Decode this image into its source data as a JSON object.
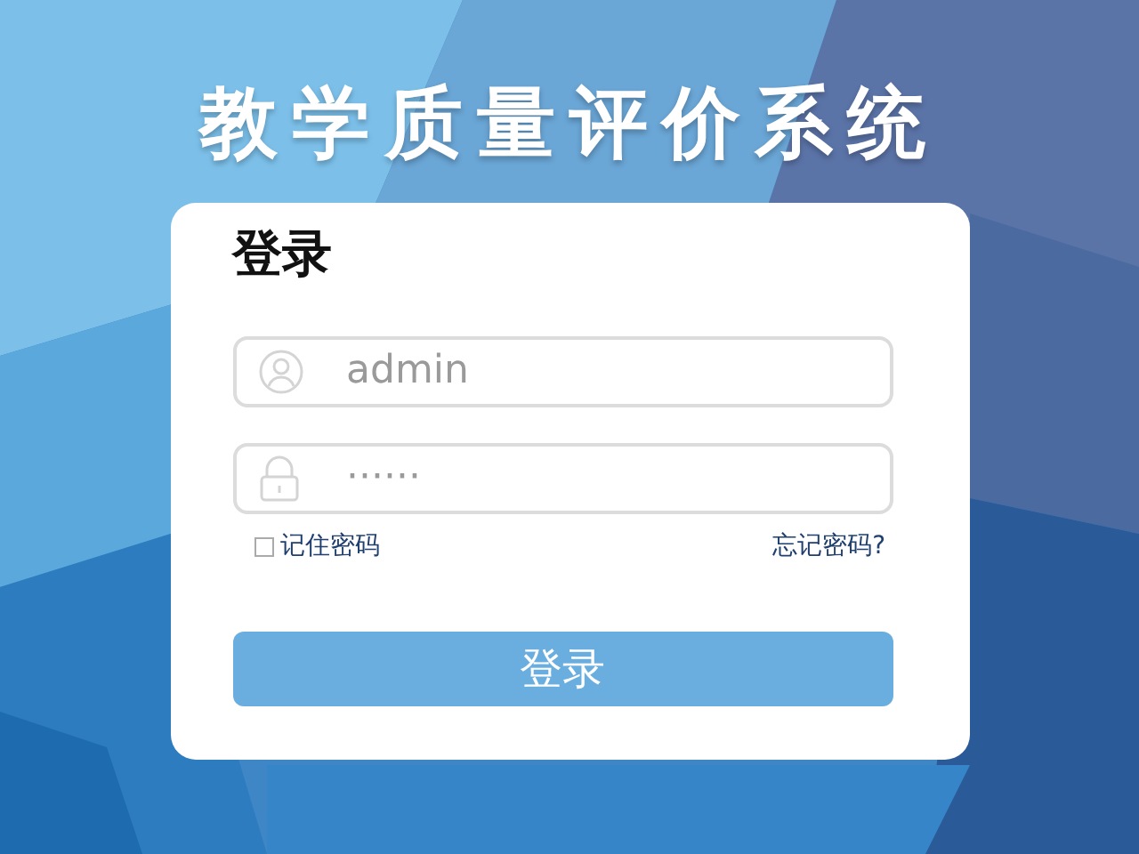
{
  "title": "教学质量评价系统",
  "login": {
    "heading": "登录",
    "username": {
      "placeholder": "admin"
    },
    "password": {
      "placeholder": "······"
    },
    "remember": {
      "label": "记住密码",
      "checked": false
    },
    "forgot": "忘记密码?",
    "submit": "登录"
  }
}
